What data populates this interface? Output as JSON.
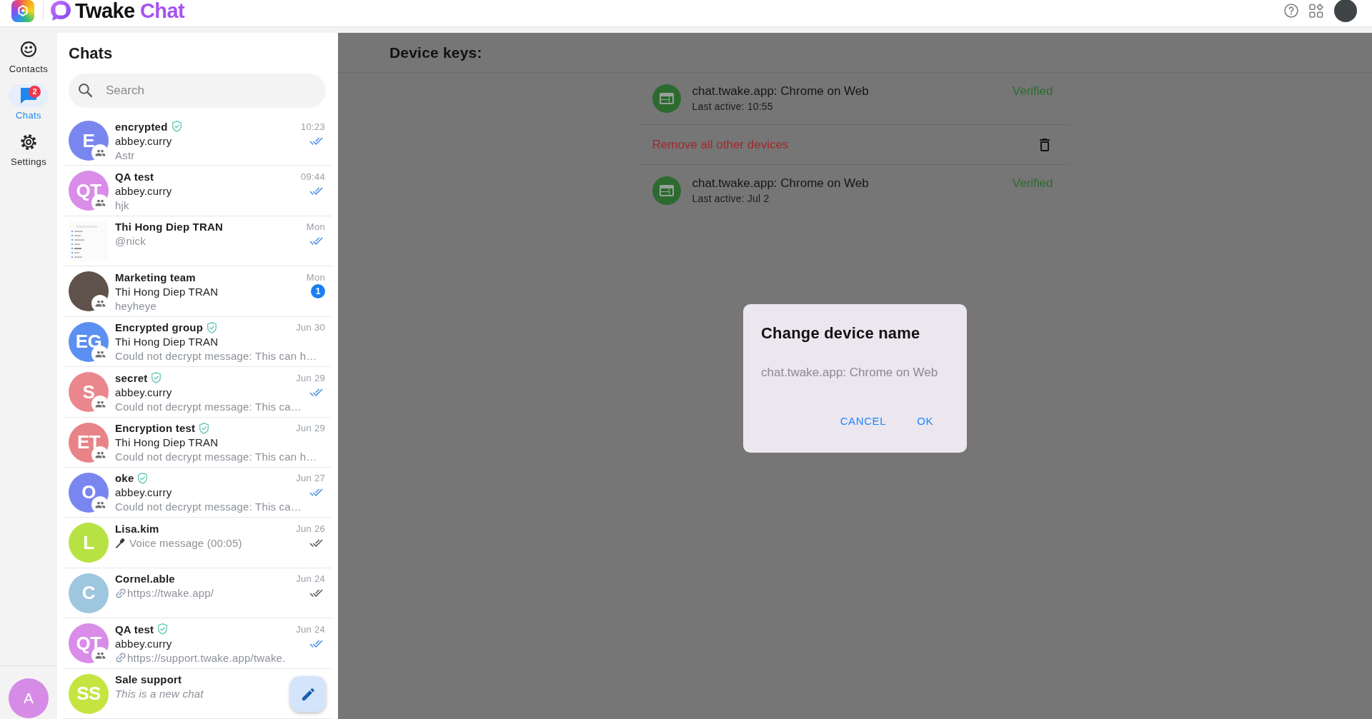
{
  "top_bar": {
    "logo": {
      "word": "Twake",
      "accent": "Chat"
    }
  },
  "nav_rail": {
    "items": [
      {
        "kind": "contacts",
        "label": "Contacts",
        "selected": false
      },
      {
        "kind": "chats",
        "label": "Chats",
        "selected": true,
        "badge": "2"
      },
      {
        "kind": "settings",
        "label": "Settings",
        "selected": false
      }
    ],
    "account": {
      "initial": "A"
    }
  },
  "chat_list": {
    "title": "Chats",
    "search": {
      "placeholder": "Search"
    },
    "rows": [
      {
        "name": "encrypted",
        "encrypted": true,
        "group": true,
        "time": "10:23",
        "sender": "abbey.curry",
        "kind": "text",
        "preview": "Astr",
        "outgoing": true,
        "read": true,
        "avatar": {
          "kind": "initials",
          "text": "E",
          "color": "#7a86f0"
        }
      },
      {
        "name": "QA test",
        "encrypted": false,
        "group": true,
        "time": "09:44",
        "sender": "abbey.curry",
        "kind": "text",
        "preview": "hjk",
        "outgoing": true,
        "read": true,
        "avatar": {
          "kind": "initials",
          "text": "QT",
          "color": "#d98ce8"
        }
      },
      {
        "name": "Thi Hong Diep TRAN",
        "encrypted": false,
        "group": false,
        "time": "Mon",
        "kind": "text",
        "preview": "@nick",
        "outgoing": true,
        "read": true,
        "avatar": {
          "kind": "thumbnail"
        }
      },
      {
        "name": "Marketing team",
        "encrypted": false,
        "group": true,
        "time": "Mon",
        "sender": "Thi Hong Diep TRAN",
        "kind": "text",
        "preview": "heyheye",
        "outgoing": false,
        "unread": "1",
        "avatar": {
          "kind": "photo"
        }
      },
      {
        "name": "Encrypted group",
        "encrypted": true,
        "group": true,
        "time": "Jun 30",
        "sender": "Thi Hong Diep TRAN",
        "kind": "text",
        "preview": "Could not decrypt message: This can h…",
        "outgoing": false,
        "avatar": {
          "kind": "initials",
          "text": "EG",
          "color": "#5c8ff2"
        }
      },
      {
        "name": "secret",
        "encrypted": true,
        "group": true,
        "time": "Jun 29",
        "sender": "abbey.curry",
        "kind": "text",
        "preview": "Could not decrypt message: This ca…",
        "outgoing": true,
        "read": true,
        "avatar": {
          "kind": "initials",
          "text": "S",
          "color": "#ea878d"
        }
      },
      {
        "name": "Encryption test",
        "encrypted": true,
        "group": true,
        "time": "Jun 29",
        "sender": "Thi Hong Diep TRAN",
        "kind": "text",
        "preview": "Could not decrypt message: This can h…",
        "outgoing": false,
        "avatar": {
          "kind": "initials",
          "text": "ET",
          "color": "#e88388"
        }
      },
      {
        "name": "oke",
        "encrypted": true,
        "group": true,
        "time": "Jun 27",
        "sender": "abbey.curry",
        "kind": "text",
        "preview": "Could not decrypt message: This ca…",
        "outgoing": true,
        "read": true,
        "avatar": {
          "kind": "initials",
          "text": "O",
          "color": "#7a86f0"
        }
      },
      {
        "name": "Lisa.kim",
        "encrypted": false,
        "group": false,
        "time": "Jun 26",
        "kind": "voice",
        "preview": "Voice message (00:05)",
        "outgoing": true,
        "read": false,
        "avatar": {
          "kind": "initials",
          "text": "L",
          "color": "#b8e244"
        }
      },
      {
        "name": "Cornel.able",
        "encrypted": false,
        "group": false,
        "time": "Jun 24",
        "kind": "link",
        "preview": "https://twake.app/",
        "outgoing": true,
        "read": false,
        "avatar": {
          "kind": "initials",
          "text": "C",
          "color": "#9fc6df"
        }
      },
      {
        "name": "QA test",
        "encrypted": true,
        "group": true,
        "time": "Jun 24",
        "sender": "abbey.curry",
        "kind": "link",
        "preview": "https://support.twake.app/twake.",
        "outgoing": true,
        "read": true,
        "avatar": {
          "kind": "initials",
          "text": "QT",
          "color": "#d98ce8"
        }
      },
      {
        "name": "Sale support",
        "encrypted": false,
        "group": false,
        "kind": "empty",
        "preview": "This is a new chat",
        "outgoing": false,
        "avatar": {
          "kind": "initials",
          "text": "SS",
          "color": "#c6e440"
        }
      }
    ]
  },
  "device_keys": {
    "title": "Device keys:",
    "items": [
      {
        "kind": "device",
        "name": "chat.twake.app: Chrome on Web",
        "last_active": "Last active: 10:55",
        "status": "Verified"
      },
      {
        "kind": "action",
        "label": "Remove all other devices"
      },
      {
        "kind": "device",
        "name": "chat.twake.app: Chrome on Web",
        "last_active": "Last active: Jul 2",
        "status": "Verified"
      }
    ]
  },
  "dialog": {
    "title": "Change device name",
    "field": {
      "placeholder": "chat.twake.app: Chrome on Web"
    },
    "buttons": [
      "CANCEL",
      "OK"
    ]
  }
}
